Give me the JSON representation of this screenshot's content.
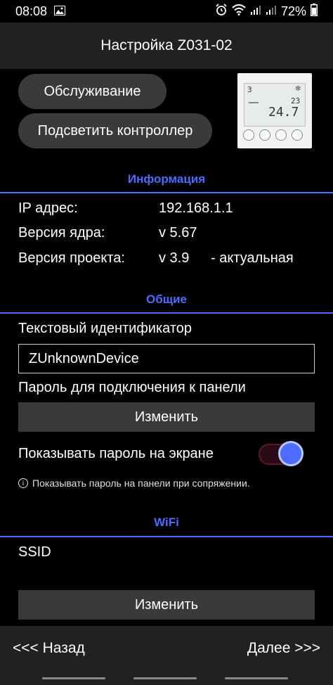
{
  "status_bar": {
    "time": "08:08",
    "battery": "72%",
    "icons": [
      "image-icon",
      "alarm-icon",
      "wifi-icon",
      "signal-icon",
      "signal-icon",
      "battery-icon"
    ]
  },
  "header": {
    "title": "Настройка Z031-02"
  },
  "actions": {
    "service_label": "Обслуживание",
    "highlight_label": "Подсветить контроллер"
  },
  "info": {
    "section_title": "Информация",
    "ip_label": "IP адрес:",
    "ip_value": "192.168.1.1",
    "core_label": "Версия ядра:",
    "core_value": "v 5.67",
    "project_label": "Версия проекта:",
    "project_value": "v 3.9",
    "project_status": "- актуальная"
  },
  "general": {
    "section_title": "Общие",
    "text_id_label": "Текстовый идентификатор",
    "text_id_value": "ZUnknownDevice",
    "password_label": "Пароль для подключения к панели",
    "change_label": "Изменить",
    "show_password_label": "Показывать пароль на экране",
    "show_password_on": true,
    "hint": "Показывать пароль на панели при сопряжении."
  },
  "wifi": {
    "section_title": "WiFi",
    "ssid_label": "SSID",
    "change_label": "Изменить"
  },
  "nav": {
    "back_label": "<<< Назад",
    "next_label": "Далее >>>"
  },
  "thumbnail": {
    "mode_digit": "3",
    "set_temp": "23",
    "current_temp": "24.7"
  },
  "colors": {
    "accent": "#4f6bff",
    "button_bg": "#3a3a3a",
    "bar_bg": "#212121"
  }
}
